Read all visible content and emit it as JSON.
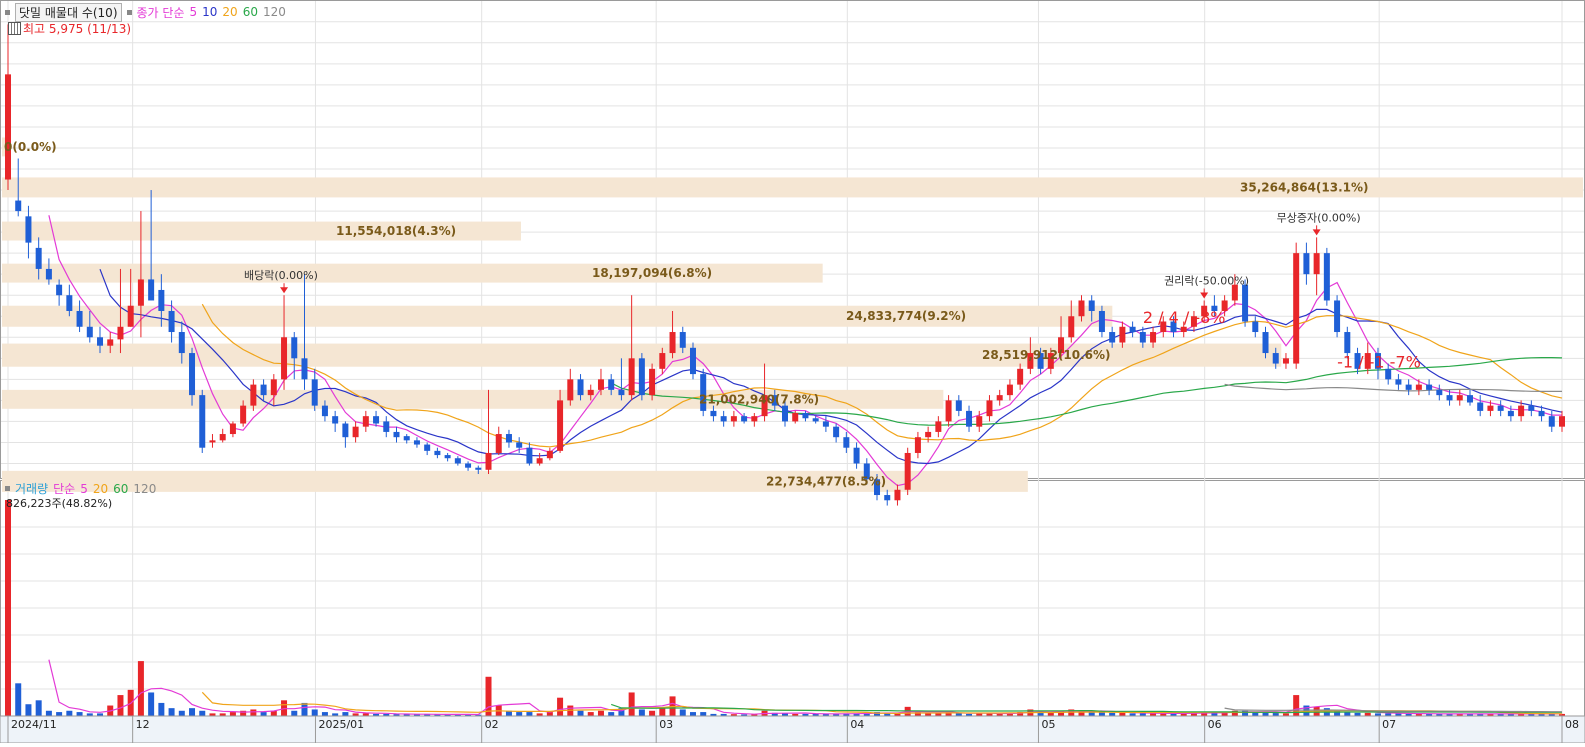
{
  "price_legend": {
    "title": "닷밀 매물대 수(10)",
    "ma_label": "종가 단순",
    "periods": [
      "5",
      "10",
      "20",
      "60",
      "120"
    ],
    "high_label": "최고 5,975 (11/13)"
  },
  "volume_legend": {
    "title": "거래량",
    "ma_label": "단순",
    "periods": [
      "5",
      "20",
      "60",
      "120"
    ],
    "max_label": "826,223주(48.82%)"
  },
  "colors": {
    "up": "#e8262a",
    "down": "#1f5fd6",
    "ma5": "#e33ad6",
    "ma10": "#2a35c8",
    "ma20": "#f0a41a",
    "ma60": "#2aa84a",
    "ma120": "#8a8a8a",
    "profile": "#f5e6d3",
    "profile_text": "#7a5a1a",
    "annot": "#e8262a"
  },
  "x_axis_labels": [
    "2024/11",
    "12",
    "2025/01",
    "02",
    "03",
    "04",
    "05",
    "06",
    "07",
    "08"
  ],
  "volume_profile_labels": [
    "0(0.0%)",
    "11,554,018(4.3%)",
    "18,197,094(6.8%)",
    "24,833,774(9.2%)",
    "28,519,912(10.6%)",
    "21,002,940(7.8%)",
    "22,734,477(8.5%)",
    "35,264,864(13.1%)"
  ],
  "event_labels": [
    "배당락(0.00%)",
    "권리락(-50.00%)",
    "무상증자(0.00%)"
  ],
  "annotations": [
    "2 / 4 / -8%",
    "-1 / -1 -7%"
  ],
  "chart_data": {
    "type": "candlestick",
    "title": "닷밀 매물대 수(10)",
    "x_range": [
      "2024/11",
      "08"
    ],
    "y_price_range": [
      1700,
      6150
    ],
    "grid": true,
    "candles": [
      [
        4500,
        5500,
        5975,
        4400,
        826
      ],
      [
        4300,
        4200,
        4700,
        4150,
        125
      ],
      [
        4150,
        3900,
        4250,
        3750,
        45
      ],
      [
        3850,
        3650,
        3950,
        3550,
        60
      ],
      [
        3650,
        3550,
        3750,
        3500,
        20
      ],
      [
        3500,
        3400,
        3550,
        3300,
        15
      ],
      [
        3400,
        3250,
        3500,
        3200,
        20
      ],
      [
        3250,
        3100,
        3350,
        3050,
        15
      ],
      [
        3100,
        3000,
        3250,
        2950,
        10
      ],
      [
        3000,
        2920,
        3100,
        2850,
        10
      ],
      [
        2920,
        2980,
        3050,
        2850,
        40
      ],
      [
        2980,
        3100,
        3650,
        2850,
        80
      ],
      [
        3100,
        3300,
        3650,
        3100,
        100
      ],
      [
        3300,
        3550,
        4200,
        3000,
        210
      ],
      [
        3550,
        3350,
        4400,
        3350,
        90
      ],
      [
        3450,
        3250,
        3600,
        3100,
        50
      ],
      [
        3250,
        3050,
        3350,
        2950,
        30
      ],
      [
        3050,
        2850,
        3150,
        2750,
        20
      ],
      [
        2850,
        2450,
        2900,
        2350,
        30
      ],
      [
        2450,
        1950,
        2500,
        1900,
        20
      ],
      [
        2000,
        2020,
        2080,
        1950,
        10
      ],
      [
        2020,
        2080,
        2130,
        2000,
        10
      ],
      [
        2080,
        2180,
        2200,
        2050,
        15
      ],
      [
        2180,
        2350,
        2400,
        2150,
        20
      ],
      [
        2350,
        2550,
        2600,
        2300,
        25
      ],
      [
        2550,
        2450,
        2600,
        2400,
        15
      ],
      [
        2450,
        2600,
        2650,
        2350,
        20
      ],
      [
        2600,
        3000,
        3400,
        2500,
        60
      ],
      [
        3000,
        2800,
        3050,
        2600,
        20
      ],
      [
        2800,
        2600,
        3600,
        2500,
        50
      ],
      [
        2600,
        2350,
        2700,
        2300,
        25
      ],
      [
        2350,
        2250,
        2400,
        2200,
        15
      ],
      [
        2250,
        2180,
        2300,
        2100,
        10
      ],
      [
        2180,
        2050,
        2200,
        1950,
        15
      ],
      [
        2050,
        2150,
        2200,
        2000,
        10
      ],
      [
        2150,
        2250,
        2300,
        2100,
        10
      ],
      [
        2250,
        2180,
        2300,
        2150,
        8
      ],
      [
        2200,
        2100,
        2250,
        2050,
        8
      ],
      [
        2100,
        2050,
        2150,
        2000,
        7
      ],
      [
        2060,
        2020,
        2080,
        1990,
        6
      ],
      [
        2020,
        1980,
        2050,
        1950,
        6
      ],
      [
        1980,
        1920,
        2000,
        1880,
        7
      ],
      [
        1920,
        1880,
        1950,
        1850,
        6
      ],
      [
        1880,
        1850,
        1900,
        1820,
        6
      ],
      [
        1850,
        1800,
        1870,
        1780,
        6
      ],
      [
        1800,
        1760,
        1820,
        1730,
        5
      ],
      [
        1760,
        1740,
        1780,
        1700,
        5
      ],
      [
        1740,
        1900,
        2500,
        1700,
        150
      ],
      [
        1900,
        2080,
        2150,
        1880,
        40
      ],
      [
        2080,
        2000,
        2120,
        1950,
        20
      ],
      [
        2000,
        1950,
        2050,
        1900,
        15
      ],
      [
        1950,
        1800,
        2000,
        1780,
        15
      ],
      [
        1800,
        1850,
        1900,
        1780,
        10
      ],
      [
        1850,
        1920,
        1950,
        1830,
        15
      ],
      [
        1920,
        2400,
        2500,
        1900,
        70
      ],
      [
        2400,
        2600,
        2700,
        2350,
        40
      ],
      [
        2600,
        2450,
        2650,
        2400,
        20
      ],
      [
        2450,
        2500,
        2550,
        2400,
        15
      ],
      [
        2500,
        2600,
        2700,
        2450,
        20
      ],
      [
        2600,
        2500,
        2650,
        2450,
        15
      ],
      [
        2500,
        2450,
        2800,
        2400,
        30
      ],
      [
        2450,
        2800,
        3400,
        2400,
        90
      ],
      [
        2800,
        2450,
        2850,
        2400,
        25
      ],
      [
        2450,
        2700,
        2750,
        2400,
        20
      ],
      [
        2700,
        2850,
        2900,
        2650,
        30
      ],
      [
        2850,
        3050,
        3250,
        2800,
        75
      ],
      [
        3050,
        2900,
        3100,
        2850,
        25
      ],
      [
        2900,
        2650,
        2950,
        2600,
        15
      ],
      [
        2650,
        2300,
        2700,
        2250,
        15
      ],
      [
        2300,
        2250,
        2350,
        2200,
        8
      ],
      [
        2250,
        2200,
        2300,
        2150,
        8
      ],
      [
        2200,
        2250,
        2300,
        2150,
        7
      ],
      [
        2250,
        2200,
        2280,
        2180,
        6
      ],
      [
        2200,
        2250,
        2280,
        2150,
        6
      ],
      [
        2250,
        2450,
        2750,
        2200,
        20
      ],
      [
        2450,
        2350,
        2500,
        2300,
        12
      ],
      [
        2350,
        2200,
        2400,
        2150,
        10
      ],
      [
        2200,
        2280,
        2300,
        2180,
        8
      ],
      [
        2280,
        2230,
        2300,
        2200,
        8
      ],
      [
        2230,
        2200,
        2250,
        2180,
        8
      ],
      [
        2200,
        2150,
        2250,
        2100,
        8
      ],
      [
        2150,
        2050,
        2180,
        2000,
        8
      ],
      [
        2050,
        1950,
        2100,
        1900,
        10
      ],
      [
        1950,
        1800,
        2000,
        1750,
        10
      ],
      [
        1800,
        1650,
        1850,
        1600,
        12
      ],
      [
        1650,
        1500,
        1700,
        1450,
        15
      ],
      [
        1500,
        1450,
        1550,
        1400,
        10
      ],
      [
        1450,
        1550,
        1600,
        1400,
        10
      ],
      [
        1550,
        1900,
        1950,
        1500,
        35
      ],
      [
        1900,
        2050,
        2100,
        1850,
        15
      ],
      [
        2050,
        2100,
        2150,
        2000,
        10
      ],
      [
        2100,
        2200,
        2250,
        2050,
        10
      ],
      [
        2200,
        2400,
        2450,
        2150,
        15
      ],
      [
        2400,
        2300,
        2450,
        2250,
        10
      ],
      [
        2300,
        2150,
        2350,
        2100,
        8
      ],
      [
        2150,
        2250,
        2300,
        2100,
        10
      ],
      [
        2250,
        2400,
        2450,
        2200,
        10
      ],
      [
        2400,
        2450,
        2500,
        2350,
        10
      ],
      [
        2450,
        2550,
        2600,
        2400,
        10
      ],
      [
        2550,
        2700,
        2750,
        2500,
        15
      ],
      [
        2700,
        2850,
        3000,
        2650,
        25
      ],
      [
        2850,
        2700,
        2900,
        2650,
        15
      ],
      [
        2700,
        2850,
        2900,
        2650,
        12
      ],
      [
        2850,
        3000,
        3200,
        2800,
        20
      ],
      [
        3000,
        3200,
        3350,
        2950,
        25
      ],
      [
        3200,
        3350,
        3400,
        3150,
        20
      ],
      [
        3350,
        3250,
        3400,
        3150,
        15
      ],
      [
        3250,
        3050,
        3300,
        3000,
        15
      ],
      [
        3050,
        2950,
        3100,
        2900,
        12
      ],
      [
        2950,
        3100,
        3150,
        2900,
        12
      ],
      [
        3100,
        3050,
        3150,
        3000,
        10
      ],
      [
        3050,
        2950,
        3100,
        2900,
        10
      ],
      [
        2950,
        3050,
        3100,
        2900,
        10
      ],
      [
        3050,
        3150,
        3200,
        3000,
        10
      ],
      [
        3150,
        3050,
        3200,
        3000,
        10
      ],
      [
        3050,
        3100,
        3150,
        3000,
        10
      ],
      [
        3100,
        3200,
        3250,
        3050,
        12
      ],
      [
        3200,
        3300,
        3350,
        3150,
        15
      ],
      [
        3300,
        3250,
        3400,
        3200,
        12
      ],
      [
        3250,
        3350,
        3400,
        3200,
        12
      ],
      [
        3350,
        3500,
        3600,
        3300,
        20
      ],
      [
        3500,
        3150,
        3550,
        3100,
        20
      ],
      [
        3150,
        3050,
        3200,
        3000,
        15
      ],
      [
        3050,
        2850,
        3100,
        2800,
        15
      ],
      [
        2850,
        2750,
        2900,
        2700,
        12
      ],
      [
        2750,
        2800,
        2850,
        2700,
        10
      ],
      [
        2750,
        3800,
        3900,
        2700,
        80
      ],
      [
        3800,
        3600,
        3900,
        3500,
        40
      ],
      [
        3600,
        3800,
        3950,
        3400,
        35
      ],
      [
        3800,
        3350,
        3850,
        3300,
        30
      ],
      [
        3350,
        3050,
        3400,
        3000,
        20
      ],
      [
        3050,
        2850,
        3100,
        2800,
        15
      ],
      [
        2850,
        2700,
        2900,
        2650,
        12
      ],
      [
        2700,
        2850,
        2950,
        2650,
        12
      ],
      [
        2850,
        2700,
        2900,
        2600,
        10
      ],
      [
        2700,
        2600,
        2750,
        2550,
        10
      ],
      [
        2600,
        2550,
        2650,
        2500,
        10
      ],
      [
        2550,
        2500,
        2600,
        2450,
        8
      ],
      [
        2500,
        2550,
        2600,
        2450,
        8
      ],
      [
        2550,
        2500,
        2600,
        2450,
        8
      ],
      [
        2500,
        2450,
        2550,
        2400,
        8
      ],
      [
        2450,
        2400,
        2500,
        2350,
        8
      ],
      [
        2400,
        2450,
        2500,
        2350,
        8
      ],
      [
        2450,
        2380,
        2500,
        2350,
        8
      ],
      [
        2380,
        2300,
        2450,
        2250,
        8
      ],
      [
        2300,
        2350,
        2400,
        2250,
        8
      ],
      [
        2350,
        2300,
        2400,
        2250,
        8
      ],
      [
        2300,
        2250,
        2350,
        2200,
        8
      ],
      [
        2250,
        2350,
        2400,
        2200,
        8
      ],
      [
        2350,
        2300,
        2400,
        2250,
        8
      ],
      [
        2300,
        2250,
        2350,
        2200,
        8
      ],
      [
        2250,
        2150,
        2300,
        2100,
        8
      ],
      [
        2150,
        2250,
        2300,
        2100,
        8
      ]
    ],
    "volume_profile": [
      {
        "label": "0(0.0%)",
        "price": [
          4720,
          4900
        ],
        "value": 0,
        "pct": 0.0
      },
      {
        "label": "11,554,018(4.3%)",
        "price": [
          3920,
          4100
        ],
        "value": 11554018,
        "pct": 4.3
      },
      {
        "label": "18,197,094(6.8%)",
        "price": [
          3520,
          3700
        ],
        "value": 18197094,
        "pct": 6.8
      },
      {
        "label": "24,833,774(9.2%)",
        "price": [
          3100,
          3300
        ],
        "value": 24833774,
        "pct": 9.2
      },
      {
        "label": "28,519,912(10.6%)",
        "price": [
          2720,
          2940
        ],
        "value": 28519912,
        "pct": 10.6
      },
      {
        "label": "21,002,940(7.8%)",
        "price": [
          2320,
          2500
        ],
        "value": 21002940,
        "pct": 7.8
      },
      {
        "label": "22,734,477(8.5%)",
        "price": [
          1530,
          1730
        ],
        "value": 22734477,
        "pct": 8.5
      },
      {
        "label": "35,264,864(13.1%)",
        "price": [
          4330,
          4520
        ],
        "value": 35264864,
        "pct": 13.1
      }
    ],
    "events": [
      {
        "label": "배당락(0.00%)",
        "index": 27
      },
      {
        "label": "권리락(-50.00%)",
        "index": 117
      },
      {
        "label": "무상증자(0.00%)",
        "index": 128
      }
    ],
    "annotations": [
      {
        "text": "2 / 4 / -8%",
        "index": 111
      },
      {
        "text": "-1 / -1 -7%",
        "index": 130
      }
    ]
  }
}
